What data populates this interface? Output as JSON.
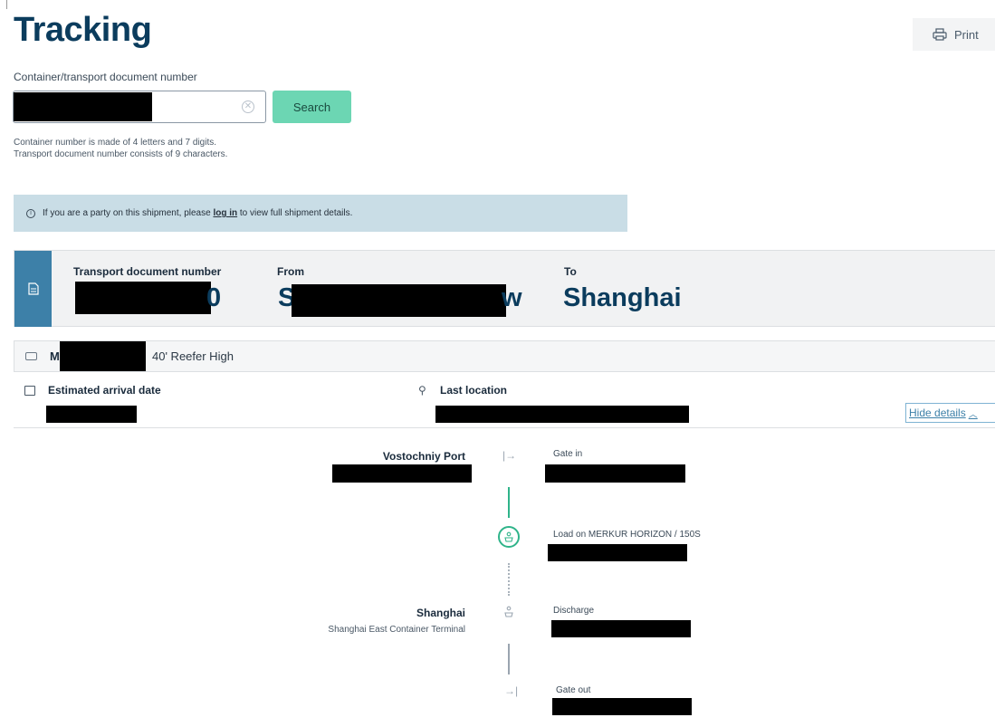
{
  "header": {
    "title": "Tracking",
    "print_label": "Print"
  },
  "search": {
    "label": "Container/transport document number",
    "button_label": "Search",
    "hint_line1": "Container number is made of 4 letters and 7 digits.",
    "hint_line2": "Transport document number consists of 9 characters."
  },
  "notice": {
    "text_before": "If you are a party on this shipment, please ",
    "link_text": "log in",
    "text_after": " to view full shipment details."
  },
  "shipment": {
    "doc_label": "Transport document number",
    "doc_value_partial": "0",
    "from_label": "From",
    "from_value_start": "S",
    "from_value_end": "w",
    "to_label": "To",
    "to_value": "Shanghai"
  },
  "container": {
    "id_partial": "M",
    "type": "40' Reefer High"
  },
  "details": {
    "eta_label": "Estimated arrival date",
    "last_location_label": "Last location",
    "hide_details_label": "Hide details"
  },
  "timeline": {
    "origin_name": "Vostochniy Port",
    "destination_name": "Shanghai",
    "destination_terminal": "Shanghai East Container Terminal",
    "events": [
      {
        "label": "Gate in"
      },
      {
        "label": "Load on MERKUR HORIZON / 150S"
      },
      {
        "label": "Discharge"
      },
      {
        "label": "Gate out"
      }
    ]
  },
  "colors": {
    "brand_dark": "#0b3c5d",
    "accent_blue": "#3d80a8",
    "search_green": "#6cd6b3",
    "timeline_green": "#2fb48a"
  }
}
